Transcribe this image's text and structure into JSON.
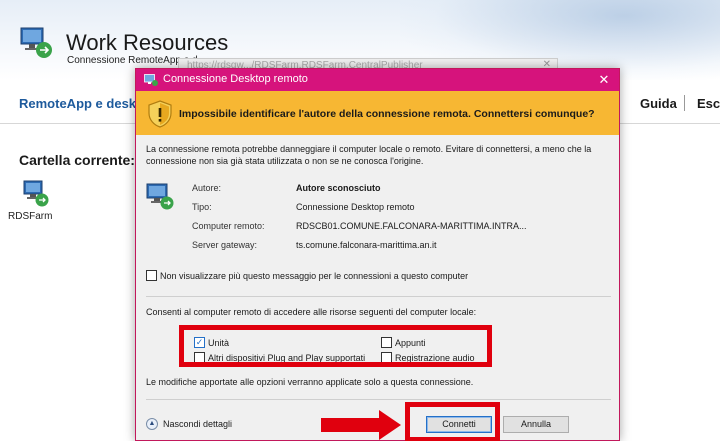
{
  "page": {
    "title": "Work Resources",
    "subtitle": "Connessione RemoteApp e d",
    "nav": {
      "remoteapp": "RemoteApp e deskto",
      "guida": "Guida",
      "esci": "Esci"
    },
    "current_folder": "Cartella corrente: /",
    "items": [
      {
        "label": "RDSFarm",
        "icon": "remote-desktop-icon"
      }
    ]
  },
  "address_tooltip": "https://rdsgw.../RDSFarm.RDSFarm.CentralPublisher",
  "dialog": {
    "title": "Connessione Desktop remoto",
    "close_symbol": "✕",
    "accent_color": "#d6137c",
    "warning": "Impossibile identificare l'autore della connessione remota. Connettersi comunque?",
    "intro": "La connessione remota potrebbe danneggiare il computer locale o remoto. Evitare di connettersi, a meno che la connessione non sia già stata utilizzata o non se ne conosca l'origine.",
    "details": [
      {
        "label": "Autore:",
        "value": "Autore sconosciuto"
      },
      {
        "label": "Tipo:",
        "value": "Connessione Desktop remoto"
      },
      {
        "label": "Computer remoto:",
        "value": "RDSCB01.COMUNE.FALCONARA-MARITTIMA.INTRA..."
      },
      {
        "label": "Server gateway:",
        "value": "ts.comune.falconara-marittima.an.it"
      }
    ],
    "dont_ask": {
      "label": "Non visualizzare più questo messaggio per le connessioni a questo computer",
      "checked": false
    },
    "resources_title": "Consenti al computer remoto di accedere alle risorse seguenti del computer locale:",
    "resources": [
      {
        "label": "Unità",
        "checked": true
      },
      {
        "label": "Appunti",
        "checked": false
      },
      {
        "label": "Altri dispositivi Plug and Play supportati",
        "checked": false
      },
      {
        "label": "Registrazione audio",
        "checked": false
      }
    ],
    "note": "Le modifiche apportate alle opzioni verranno applicate solo a questa connessione.",
    "hide_details": "Nascondi dettagli",
    "connect": "Connetti",
    "cancel": "Annulla"
  },
  "annotation_color": "#e0000e"
}
